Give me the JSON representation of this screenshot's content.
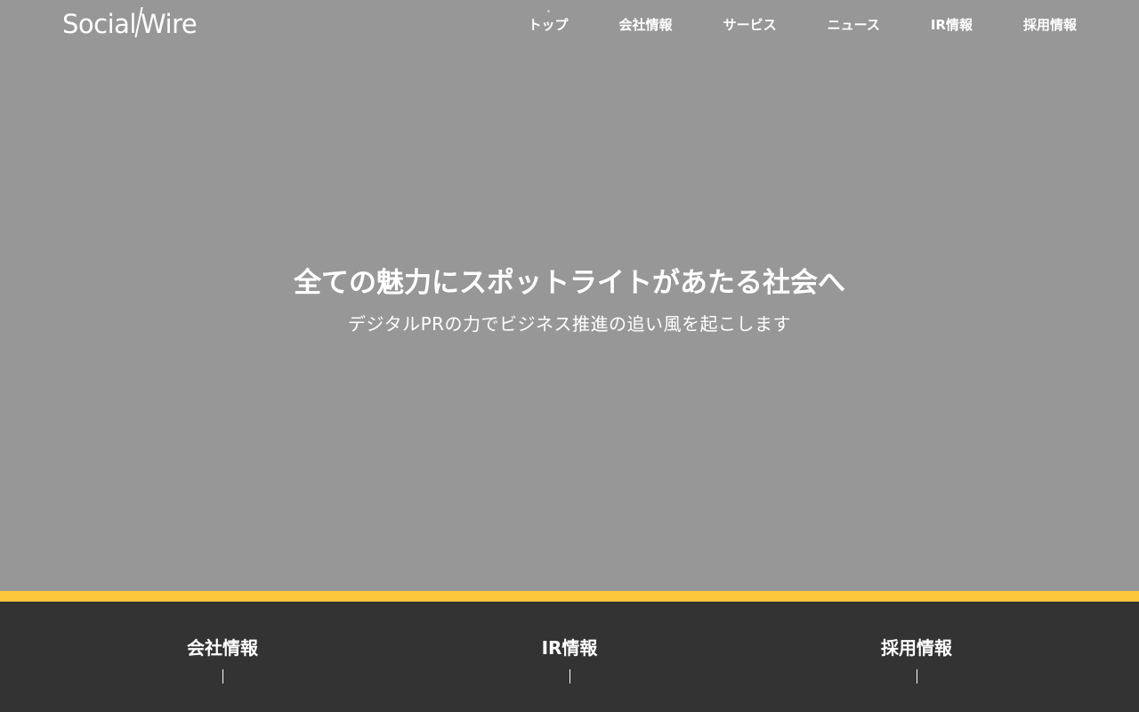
{
  "header": {
    "logo": {
      "part1": "Social",
      "part2": "Wire"
    },
    "nav": [
      {
        "label": "トップ"
      },
      {
        "label": "会社情報"
      },
      {
        "label": "サービス"
      },
      {
        "label": "ニュース"
      },
      {
        "label": "IR情報"
      },
      {
        "label": "採用情報"
      }
    ]
  },
  "hero": {
    "title": "全ての魅力にスポットライトがあたる社会へ",
    "subtitle": "デジタルPRの力でビジネス推進の追い風を起こします"
  },
  "footer_links": [
    {
      "label": "会社情報"
    },
    {
      "label": "IR情報"
    },
    {
      "label": "採用情報"
    }
  ],
  "colors": {
    "hero_background": "#979797",
    "accent": "#fdc73c",
    "footer_background": "#333333",
    "text": "#ffffff"
  }
}
